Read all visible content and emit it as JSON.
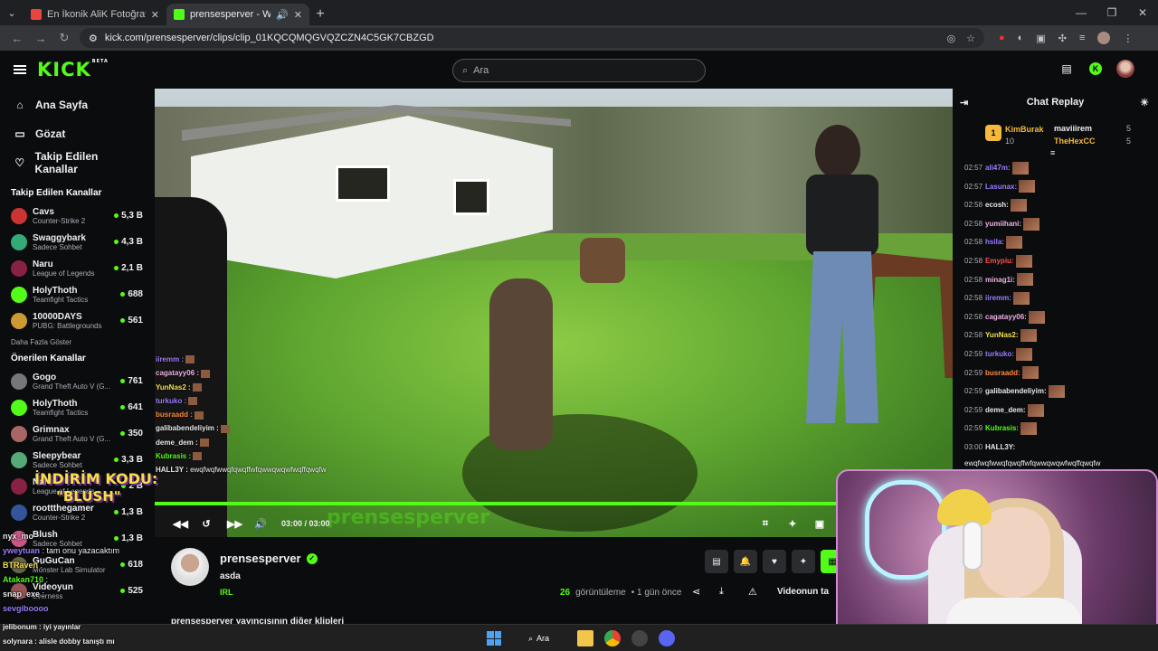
{
  "browser": {
    "tabs": [
      {
        "title": "En İkonik AliK Fotoğrafları (pre",
        "favicon_color": "#e8453c"
      },
      {
        "title": "prensesperver - Watch clips",
        "favicon_color": "#53fc18"
      }
    ],
    "url": "kick.com/prensesperver/clips/clip_01KQCQMQGVQZCZN4C5GK7CBZGD"
  },
  "header": {
    "logo": "KICK",
    "logo_badge": "BETA",
    "search_placeholder": "Ara"
  },
  "sidebar": {
    "nav": [
      {
        "label": "Ana Sayfa",
        "icon": "home-icon"
      },
      {
        "label": "Gözat",
        "icon": "browse-icon"
      },
      {
        "label": "Takip Edilen Kanallar",
        "icon": "heart-icon"
      }
    ],
    "followed_title": "Takip Edilen Kanallar",
    "followed": [
      {
        "name": "Cavs",
        "game": "Counter-Strike 2",
        "viewers": "5,3 B",
        "color": "#c33"
      },
      {
        "name": "Swaggybark",
        "game": "Sadece Sohbet",
        "viewers": "4,3 B",
        "color": "#3a7"
      },
      {
        "name": "Naru",
        "game": "League of Legends",
        "viewers": "2,1 B",
        "color": "#824"
      },
      {
        "name": "HolyThoth",
        "game": "Teamfight Tactics",
        "viewers": "688",
        "color": "#53fc18"
      },
      {
        "name": "10000DAYS",
        "game": "PUBG: Battlegrounds",
        "viewers": "561",
        "color": "#c93"
      }
    ],
    "show_more": "Daha Fazla Göster",
    "recommended_title": "Önerilen Kanallar",
    "recommended": [
      {
        "name": "Gogo",
        "game": "Grand Theft Auto V (G...",
        "viewers": "761",
        "color": "#777"
      },
      {
        "name": "HolyThoth",
        "game": "Teamfight Tactics",
        "viewers": "641",
        "color": "#53fc18"
      },
      {
        "name": "Grimnax",
        "game": "Grand Theft Auto V (G...",
        "viewers": "350",
        "color": "#a66"
      },
      {
        "name": "Sleepybear",
        "game": "Sadece Sohbet",
        "viewers": "3,3 B",
        "color": "#5a7"
      },
      {
        "name": "Naru",
        "game": "League of Legends",
        "viewers": "2 B",
        "color": "#824"
      },
      {
        "name": "roottthegamer",
        "game": "Counter-Strike 2",
        "viewers": "1,3 B",
        "color": "#359"
      },
      {
        "name": "Blush",
        "game": "Sadece Sohbet",
        "viewers": "1,3 B",
        "color": "#c58"
      },
      {
        "name": "GuGuCan",
        "game": "Monster Lab Simulator",
        "viewers": "618",
        "color": "#664"
      },
      {
        "name": "Videoyun",
        "game": "Everness",
        "viewers": "525",
        "color": "#955"
      }
    ]
  },
  "video": {
    "chat_overlay": [
      {
        "name": "iiremm :",
        "color": "#9b7cff"
      },
      {
        "name": "cagatayy06 :",
        "color": "#efb2e6"
      },
      {
        "name": "YunNas2 :",
        "color": "#f5e04a"
      },
      {
        "name": "turkuko :",
        "color": "#9b7cff"
      },
      {
        "name": "busraadd :",
        "color": "#ff8a3c"
      },
      {
        "name": "galibabendeliyim :",
        "color": "#e8e8e8"
      },
      {
        "name": "deme_dem :",
        "color": "#e8e8e8"
      },
      {
        "name": "Kubrasis :",
        "color": "#53fc18"
      },
      {
        "name": "HALL3Y :",
        "color": "#e8e8e8"
      }
    ],
    "hall3y_text": "ewqfwqfwwqfqwqffwfqwwqwqwfwqffqwqfw",
    "time": "03:00 / 03:00",
    "progress": 1.0,
    "watermark": "prensesperver"
  },
  "clip": {
    "channel": "prensesperver",
    "title": "asda",
    "category": "IRL",
    "views": "26",
    "views_label": "görüntüleme",
    "age": "• 1 gün önce",
    "report_label": "Videonun ta",
    "more_clips": "prensesperver yayıncısının diğer klipleri"
  },
  "chat": {
    "title": "Chat Replay",
    "pinned": [
      {
        "rank": "1",
        "name": "KimBurak",
        "count": "10"
      },
      {
        "name": "maviiirem",
        "count": "5"
      },
      {
        "name": "TheHexCC",
        "count": "5"
      }
    ],
    "messages": [
      {
        "time": "02:57",
        "name": "ali47m:",
        "color": "#9b7cff"
      },
      {
        "time": "02:57",
        "name": "Lasunax:",
        "color": "#9b7cff"
      },
      {
        "time": "02:58",
        "name": "ecosh:",
        "color": "#e8e8e8"
      },
      {
        "time": "02:58",
        "name": "yumiihani:",
        "color": "#efb2e6"
      },
      {
        "time": "02:58",
        "name": "hsila:",
        "color": "#9b7cff"
      },
      {
        "time": "02:58",
        "name": "Emypiu:",
        "color": "#ff4d4d"
      },
      {
        "time": "02:58",
        "name": "minag1i:",
        "color": "#efb2e6"
      },
      {
        "time": "02:58",
        "name": "iiremm:",
        "color": "#9b7cff"
      },
      {
        "time": "02:58",
        "name": "cagatayy06:",
        "color": "#efb2e6"
      },
      {
        "time": "02:58",
        "name": "YunNas2:",
        "color": "#f5e04a"
      },
      {
        "time": "02:59",
        "name": "turkuko:",
        "color": "#9b7cff"
      },
      {
        "time": "02:59",
        "name": "busraadd:",
        "color": "#ff8a3c"
      },
      {
        "time": "02:59",
        "name": "galibabendeliyim:",
        "color": "#e8e8e8"
      },
      {
        "time": "02:59",
        "name": "deme_dem:",
        "color": "#e8e8e8"
      },
      {
        "time": "02:59",
        "name": "Kubrasis:",
        "color": "#53fc18"
      },
      {
        "time": "03:00",
        "name": "HALL3Y:",
        "color": "#e8e8e8"
      }
    ],
    "last_text": "ewqfwqfwwqfqwqffwfqwwqwqwfwqffqwqfw"
  },
  "stream_overlay": {
    "promo_line1": "İNDİRİM KODU:",
    "promo_line2": "\"BLUSH\"",
    "chat": [
      {
        "name": "nyx_mo",
        "text": "",
        "color": "#e8e8e8"
      },
      {
        "name": "yweytuan",
        "text": ": tam onu yazacaktım",
        "color": "#9b7cff"
      },
      {
        "name": "BTRaven",
        "text": ":",
        "color": "#f5e04a"
      },
      {
        "name": "Atakan710",
        "text": ":",
        "color": "#53fc18"
      },
      {
        "name": "snap_exe",
        "text": ":",
        "color": "#e8e8e8"
      },
      {
        "name": "sevgiboooo",
        "text": "",
        "color": "#9b7cff"
      }
    ],
    "bottom": [
      {
        "name": "jelibonum",
        "text": ": iyi yayınlar"
      },
      {
        "name": "solynara",
        "text": ": alisle dobby tanıştı mı"
      }
    ]
  },
  "taskbar": {
    "search_label": "Ara"
  },
  "colors": {
    "accent": "#53fc18",
    "background": "#0b0c0d"
  }
}
